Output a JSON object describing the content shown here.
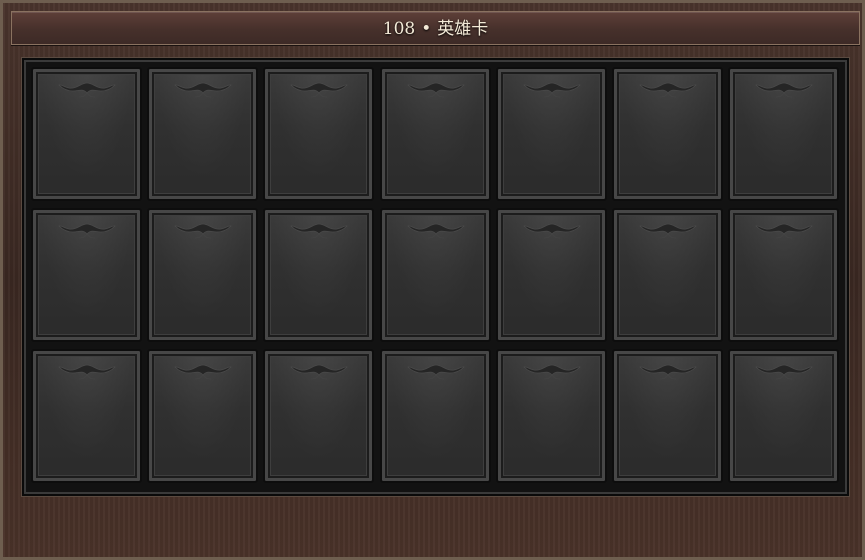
{
  "window": {
    "title_number": "108",
    "title_separator": "•",
    "title_name": "英雄卡"
  },
  "card_grid": {
    "rows": 3,
    "columns": 7,
    "slot_state": "empty"
  },
  "colors": {
    "title_bar": "#4d3530",
    "frame_bg": "#3e2b24",
    "slot_bg": "#333333",
    "title_text": "#f3ead7"
  },
  "icons": {
    "slot_ornament": "filigree-ornament-icon"
  }
}
